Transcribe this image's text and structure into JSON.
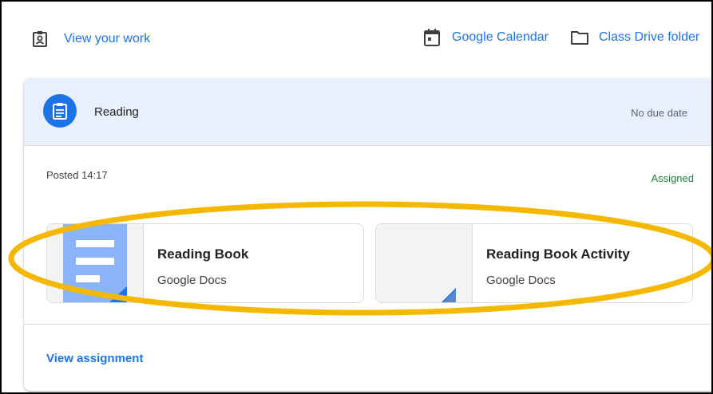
{
  "toplinks": {
    "view_work": "View your work",
    "calendar": "Google Calendar",
    "drive_folder": "Class Drive folder"
  },
  "assignment": {
    "title": "Reading",
    "due": "No due date",
    "posted": "Posted 14:17",
    "status": "Assigned",
    "attachments": [
      {
        "title": "Reading Book",
        "type": "Google Docs",
        "icon": "google-docs-thumbnail"
      },
      {
        "title": "Reading Book Activity",
        "type": "Google Docs",
        "icon": "blank-doc-thumbnail"
      }
    ],
    "view_link": "View assignment"
  },
  "colors": {
    "link": "#1a73e8",
    "header_bg": "#e8f0fe",
    "status_green": "#188038",
    "highlight": "#f5b800",
    "docs_blue": "#8ab4f8"
  },
  "icons": {
    "view_work": "person-badge-icon",
    "calendar": "calendar-icon",
    "drive_folder": "folder-icon",
    "assignment": "assignment-icon"
  }
}
